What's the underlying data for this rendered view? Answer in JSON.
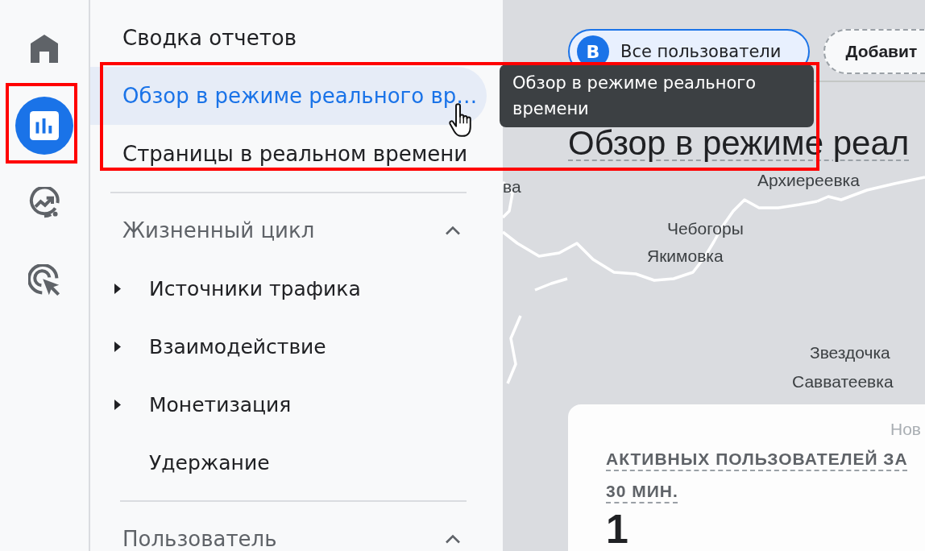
{
  "rail": {
    "items": [
      {
        "selected": false,
        "annotated": false
      },
      {
        "selected": true,
        "annotated": true
      },
      {
        "selected": false,
        "annotated": false
      },
      {
        "selected": false,
        "annotated": false
      }
    ]
  },
  "nav": {
    "links": [
      {
        "label": "Сводка отчетов",
        "selected": false,
        "hovered": false,
        "annotated": false
      },
      {
        "label": "Обзор в режиме реального вр…",
        "selected": true,
        "hovered": true,
        "annotated": true,
        "tooltip": "Обзор в режиме реального времени"
      },
      {
        "label": "Страницы в реальном времени",
        "selected": false,
        "hovered": false,
        "annotated": false
      }
    ],
    "sections": [
      {
        "title": "Жизненный цикл",
        "expanded": true,
        "items": [
          {
            "label": "Источники трафика",
            "expandable": true
          },
          {
            "label": "Взаимодействие",
            "expandable": true
          },
          {
            "label": "Монетизация",
            "expandable": true
          },
          {
            "label": "Удержание",
            "expandable": false
          }
        ]
      },
      {
        "title": "Пользователь",
        "expanded": true
      }
    ]
  },
  "header": {
    "segment": {
      "badge": "В",
      "label": "Все пользователи"
    },
    "add_button": {
      "label": "Добавит"
    }
  },
  "page_title": "Обзор в режиме реал",
  "map": {
    "labels": [
      {
        "text": "ва",
        "faded": false
      },
      {
        "text": "Архиереевка",
        "faded": false
      },
      {
        "text": "Чебогоры",
        "faded": false
      },
      {
        "text": "Якимовка",
        "faded": false
      },
      {
        "text": "Звездочка",
        "faded": false
      },
      {
        "text": "Савватеевка",
        "faded": false
      },
      {
        "text": "Нов",
        "faded": true
      }
    ]
  },
  "card": {
    "title": "АКТИВНЫХ ПОЛЬЗОВАТЕЛЕЙ ЗА 30 МИН.",
    "value": "1"
  }
}
